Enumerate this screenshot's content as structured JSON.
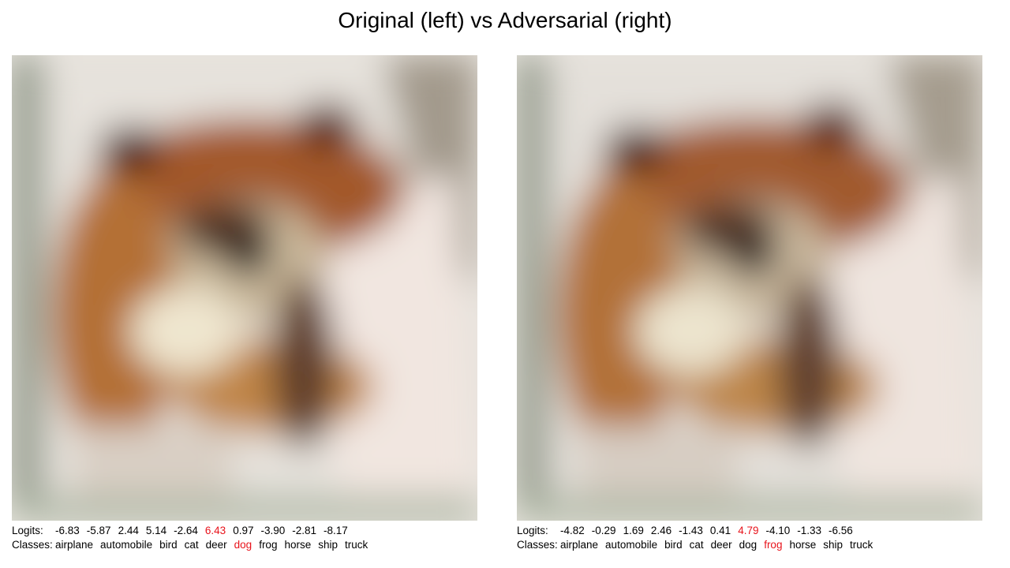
{
  "title": "Original (left) vs Adversarial (right)",
  "labels": {
    "logits": "Logits:",
    "classes": "Classes:"
  },
  "highlight_color": "#e8131b",
  "classes": [
    "airplane",
    "automobile",
    "bird",
    "cat",
    "deer",
    "dog",
    "frog",
    "horse",
    "ship",
    "truck"
  ],
  "panels": [
    {
      "name": "original",
      "logits": [
        "-6.83",
        "-5.87",
        "2.44",
        "5.14",
        "-2.64",
        "6.43",
        "0.97",
        "-3.90",
        "-2.81",
        "-8.17"
      ],
      "highlight_index": 5
    },
    {
      "name": "adversarial",
      "logits": [
        "-4.82",
        "-0.29",
        "1.69",
        "2.46",
        "-1.43",
        "0.41",
        "4.79",
        "-4.10",
        "-1.33",
        "-6.56"
      ],
      "highlight_index": 6
    }
  ]
}
